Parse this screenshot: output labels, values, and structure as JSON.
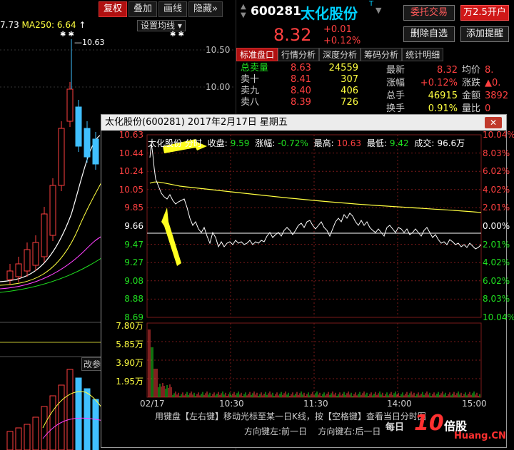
{
  "background_chart": {
    "toolbar": [
      "复权",
      "叠加",
      "画线",
      "隐藏"
    ],
    "toolbar_more": "»",
    "ma_left": "7.73",
    "ma250_label": "MA250: 6.64",
    "ma_peak": "10.63",
    "settings_label": "设置均线",
    "price_ticks": [
      "10.50",
      "10.00"
    ],
    "side_label": "改参"
  },
  "quote": {
    "code": "600281",
    "name": "太化股份",
    "name_mark": "T",
    "price": "8.32",
    "change": "+0.01",
    "change_pct": "+0.12%",
    "buttons": {
      "entrust": "委托交易",
      "open_account": "万2.5开户",
      "remove_fav": "删除自选",
      "add_alert": "添加提醒"
    },
    "tabs": [
      "标准盘口",
      "行情分析",
      "深度分析",
      "筹码分析",
      "统计明细"
    ],
    "book": [
      {
        "label": "总卖量",
        "price": "8.63",
        "vol": "24559"
      },
      {
        "label": "卖十",
        "price": "8.41",
        "vol": "307"
      },
      {
        "label": "卖九",
        "price": "8.40",
        "vol": "406"
      },
      {
        "label": "卖八",
        "price": "8.39",
        "vol": "726"
      }
    ],
    "stats": [
      {
        "k": "最新",
        "v": "8.32",
        "k2": "均价",
        "v2": "8."
      },
      {
        "k": "涨幅",
        "v": "+0.12%",
        "k2": "涨跌",
        "v2": "▲0."
      },
      {
        "k": "总手",
        "v": "46915",
        "k2": "金额",
        "v2": "3892"
      },
      {
        "k": "换手",
        "v": "0.91%",
        "k2": "量比",
        "v2": "0"
      }
    ],
    "colors": {
      "up": "#ff4040",
      "down": "#20e020",
      "name": "#00d0ff"
    }
  },
  "popup": {
    "title": "太化股份(600281) 2017年2月17日 星期五",
    "close_label": "✕",
    "info": {
      "name_label": "太化股份 分时",
      "close_k": "收盘:",
      "close_v": "9.59",
      "chg_k": "涨幅:",
      "chg_v": "-0.72%",
      "high_k": "最高:",
      "high_v": "10.63",
      "low_k": "最低:",
      "low_v": "9.42",
      "amt_k": "成交:",
      "amt_v": "96.6万"
    },
    "left_axis": [
      "10.63",
      "10.44",
      "10.24",
      "10.05",
      "9.85",
      "9.66",
      "9.47",
      "9.27",
      "9.08",
      "8.88",
      "8.69"
    ],
    "right_axis": [
      "10.04%",
      "8.03%",
      "6.02%",
      "4.02%",
      "2.01%",
      "0.00%",
      "2.01%",
      "4.02%",
      "6.02%",
      "8.03%",
      "10.04%"
    ],
    "vol_axis": [
      "7.80万",
      "5.85万",
      "3.90万",
      "1.95万"
    ],
    "times": [
      "02/17",
      "10:30",
      "11:30",
      "14:00",
      "15:00"
    ],
    "hint": "用键盘【左右键】移动光标至某一日K线，按【空格键】查看当日分时图",
    "hint2_a": "方向键左:前一日",
    "hint2_b": "方向键右:后一日"
  },
  "watermark": {
    "text": "每日",
    "brand": "10",
    "brand2": "倍股",
    "site": "Huang.CN"
  }
}
